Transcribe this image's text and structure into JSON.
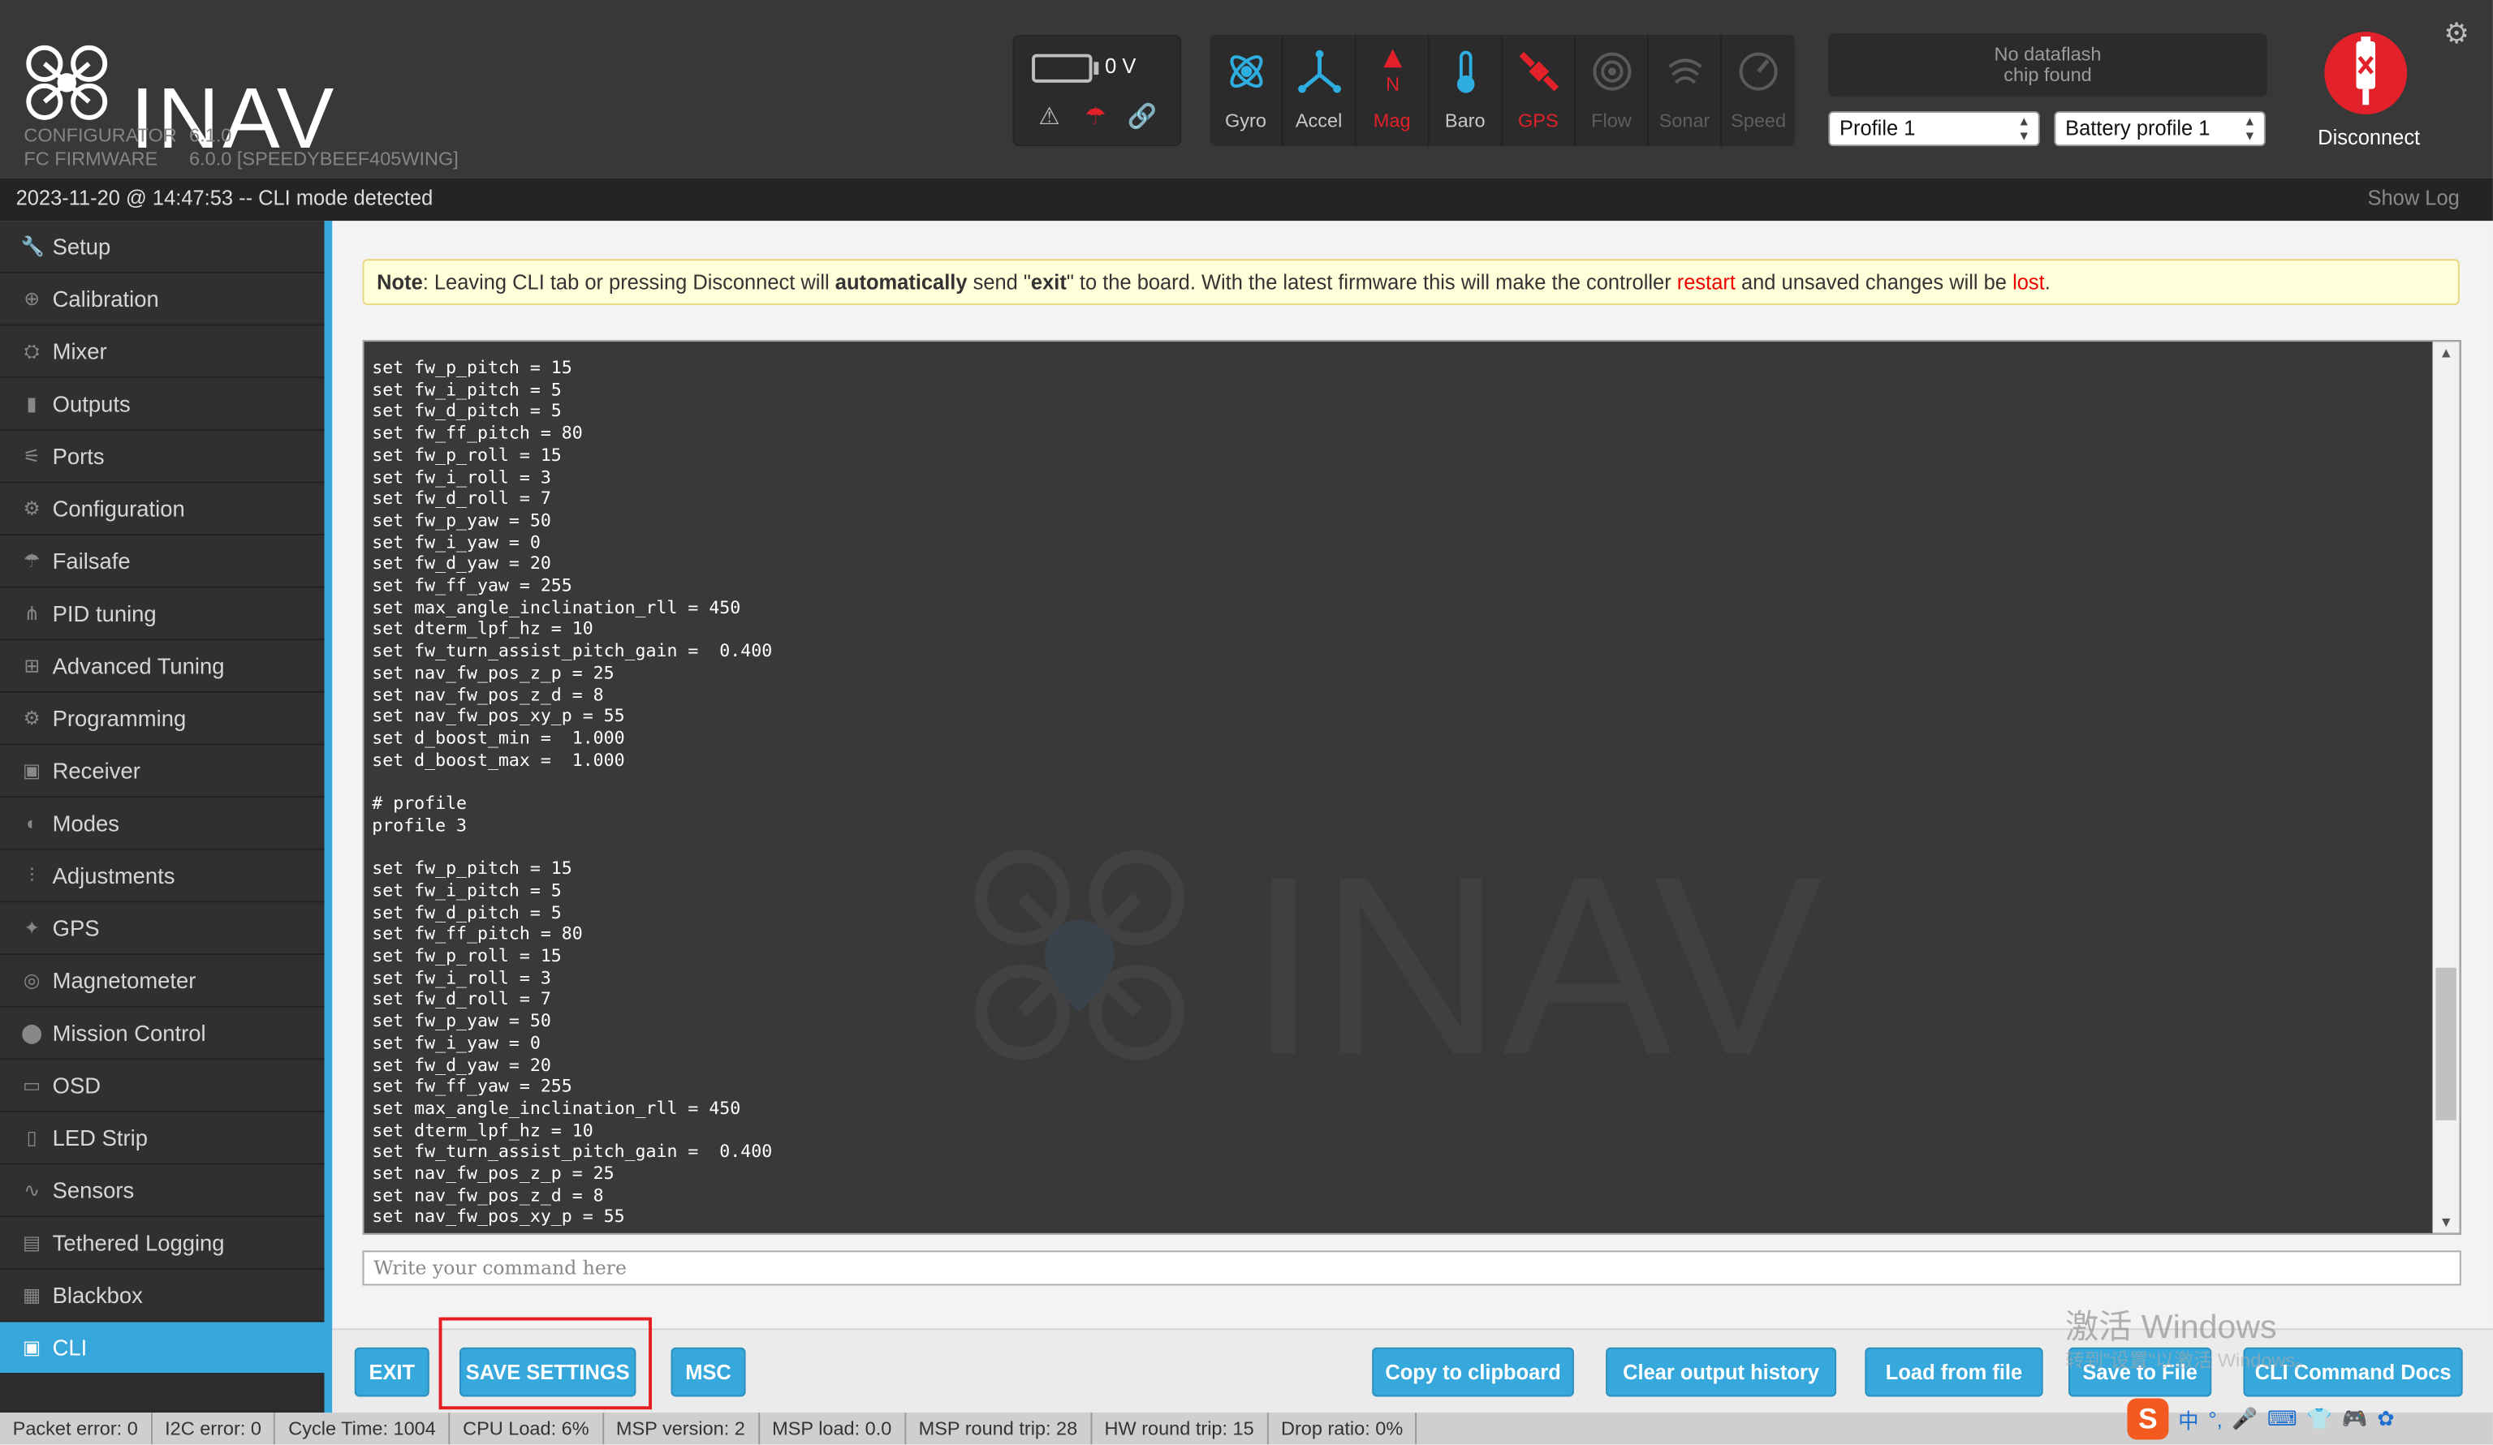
{
  "header": {
    "app_name": "INAV",
    "configurator_label": "CONFIGURATOR",
    "configurator_version": "6.1.0",
    "firmware_label": "FC FIRMWARE",
    "firmware_version": "6.0.0 [SPEEDYBEEF405WING]",
    "battery_voltage": "0 V",
    "sensors": [
      {
        "label": "Gyro",
        "state": "active",
        "icon": "gyro-icon"
      },
      {
        "label": "Accel",
        "state": "active",
        "icon": "accel-icon"
      },
      {
        "label": "Mag",
        "state": "error",
        "icon": "mag-icon"
      },
      {
        "label": "Baro",
        "state": "active",
        "icon": "baro-icon"
      },
      {
        "label": "GPS",
        "state": "error",
        "icon": "gps-icon"
      },
      {
        "label": "Flow",
        "state": "inactive",
        "icon": "flow-icon"
      },
      {
        "label": "Sonar",
        "state": "inactive",
        "icon": "sonar-icon"
      },
      {
        "label": "Speed",
        "state": "inactive",
        "icon": "speed-icon"
      }
    ],
    "dataflash_line1": "No dataflash",
    "dataflash_line2": "chip found",
    "profile_select": "Profile 1",
    "battery_profile_select": "Battery profile 1",
    "disconnect_label": "Disconnect"
  },
  "logbar": {
    "message": "2023-11-20 @ 14:47:53 -- CLI mode detected",
    "show_log": "Show Log"
  },
  "sidebar": {
    "items": [
      {
        "label": "Setup",
        "icon": "wrench-icon"
      },
      {
        "label": "Calibration",
        "icon": "crosshair-icon"
      },
      {
        "label": "Mixer",
        "icon": "mixer-icon"
      },
      {
        "label": "Outputs",
        "icon": "motor-icon"
      },
      {
        "label": "Ports",
        "icon": "plug-icon"
      },
      {
        "label": "Configuration",
        "icon": "gear-icon"
      },
      {
        "label": "Failsafe",
        "icon": "parachute-icon"
      },
      {
        "label": "PID tuning",
        "icon": "pid-icon"
      },
      {
        "label": "Advanced Tuning",
        "icon": "tree-icon"
      },
      {
        "label": "Programming",
        "icon": "gear-icon"
      },
      {
        "label": "Receiver",
        "icon": "receiver-icon"
      },
      {
        "label": "Modes",
        "icon": "toggle-icon"
      },
      {
        "label": "Adjustments",
        "icon": "sliders-icon"
      },
      {
        "label": "GPS",
        "icon": "satellite-icon"
      },
      {
        "label": "Magnetometer",
        "icon": "compass-icon"
      },
      {
        "label": "Mission Control",
        "icon": "map-pin-icon"
      },
      {
        "label": "OSD",
        "icon": "osd-icon"
      },
      {
        "label": "LED Strip",
        "icon": "led-icon"
      },
      {
        "label": "Sensors",
        "icon": "pulse-icon"
      },
      {
        "label": "Tethered Logging",
        "icon": "log-icon"
      },
      {
        "label": "Blackbox",
        "icon": "blackbox-icon"
      },
      {
        "label": "CLI",
        "icon": "terminal-icon",
        "active": true
      }
    ]
  },
  "note": {
    "prefix": "Note",
    "text_1": ": Leaving CLI tab or pressing Disconnect will ",
    "bold_1": "automatically",
    "text_2": " send \"",
    "bold_2": "exit",
    "text_3": "\" to the board. With the latest firmware this will make the controller ",
    "red_1": "restart",
    "text_4": " and unsaved changes will be ",
    "red_2": "lost",
    "text_5": "."
  },
  "console": {
    "lines": [
      "set fw_p_pitch = 15",
      "set fw_i_pitch = 5",
      "set fw_d_pitch = 5",
      "set fw_ff_pitch = 80",
      "set fw_p_roll = 15",
      "set fw_i_roll = 3",
      "set fw_d_roll = 7",
      "set fw_p_yaw = 50",
      "set fw_i_yaw = 0",
      "set fw_d_yaw = 20",
      "set fw_ff_yaw = 255",
      "set max_angle_inclination_rll = 450",
      "set dterm_lpf_hz = 10",
      "set fw_turn_assist_pitch_gain =  0.400",
      "set nav_fw_pos_z_p = 25",
      "set nav_fw_pos_z_d = 8",
      "set nav_fw_pos_xy_p = 55",
      "set d_boost_min =  1.000",
      "set d_boost_max =  1.000",
      "",
      "# profile",
      "profile 3",
      "",
      "set fw_p_pitch = 15",
      "set fw_i_pitch = 5",
      "set fw_d_pitch = 5",
      "set fw_ff_pitch = 80",
      "set fw_p_roll = 15",
      "set fw_i_roll = 3",
      "set fw_d_roll = 7",
      "set fw_p_yaw = 50",
      "set fw_i_yaw = 0",
      "set fw_d_yaw = 20",
      "set fw_ff_yaw = 255",
      "set max_angle_inclination_rll = 450",
      "set dterm_lpf_hz = 10",
      "set fw_turn_assist_pitch_gain =  0.400",
      "set nav_fw_pos_z_p = 25",
      "set nav_fw_pos_z_d = 8",
      "set nav_fw_pos_xy_p = 55"
    ],
    "input_placeholder": "Write your command here"
  },
  "toolbar": {
    "exit": "EXIT",
    "save_settings": "SAVE SETTINGS",
    "msc": "MSC",
    "copy": "Copy to clipboard",
    "clear": "Clear output history",
    "load": "Load from file",
    "save_file": "Save to File",
    "docs": "CLI Command Docs"
  },
  "watermark": {
    "line1": "激活 Windows",
    "line2": "转到\"设置\"以激活 Windows。"
  },
  "statusbar": {
    "packet_error": "Packet error: 0",
    "i2c_error": "I2C error: 0",
    "cycle_time": "Cycle Time: 1004",
    "cpu_load": "CPU Load: 6%",
    "msp_version": "MSP version: 2",
    "msp_load": "MSP load: 0.0",
    "msp_round_trip": "MSP round trip: 28",
    "hw_round_trip": "HW round trip: 15",
    "drop_ratio": "Drop ratio: 0%"
  },
  "tray": {
    "ime_lang": "中",
    "items": [
      "°,",
      "🎤",
      "⌨",
      "👕",
      "🎮",
      "✿"
    ]
  },
  "colors": {
    "accent": "#37a8dc",
    "header_bg": "#383838",
    "error_red": "#e2212b",
    "highlight_red": "#e51e22"
  }
}
